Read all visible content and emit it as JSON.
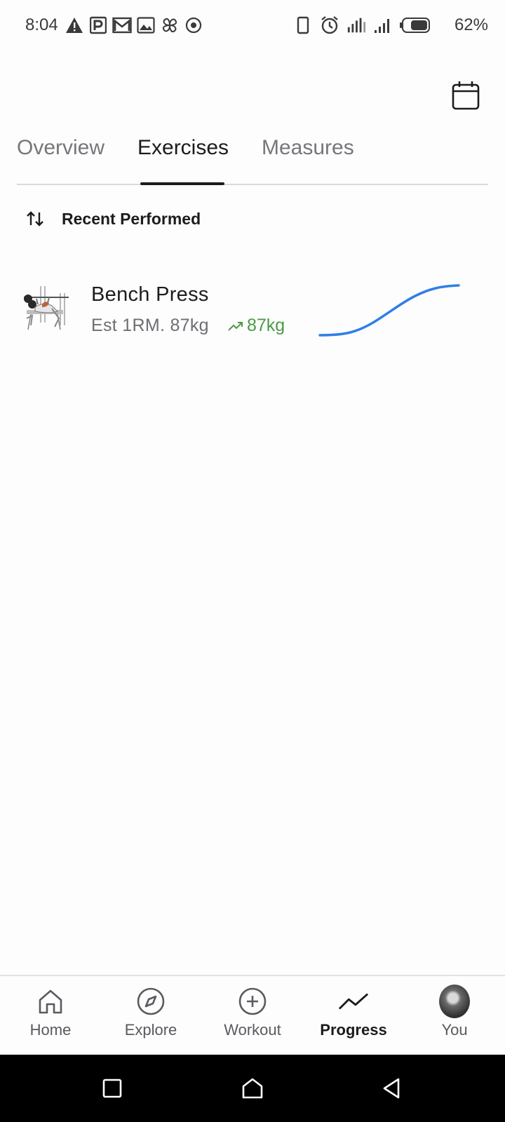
{
  "status_bar": {
    "time": "8:04",
    "battery_percent": "62%",
    "left_icons": [
      "warning-icon",
      "parking-icon",
      "gmail-icon",
      "image-icon",
      "pinwheel-icon",
      "target-icon"
    ],
    "right_icons": [
      "vibrate-icon",
      "alarm-icon",
      "signal-icon",
      "signal-icon",
      "battery-icon"
    ]
  },
  "header": {
    "calendar_icon": "calendar-icon"
  },
  "tabs": [
    {
      "label": "Overview",
      "active": false
    },
    {
      "label": "Exercises",
      "active": true
    },
    {
      "label": "Measures",
      "active": false
    }
  ],
  "sort": {
    "label": "Recent Performed",
    "icon": "sort-arrows-icon"
  },
  "exercises": [
    {
      "name": "Bench Press",
      "estimate": "Est 1RM. 87kg",
      "trend": "87kg",
      "trend_icon": "trending-up-icon"
    }
  ],
  "bottom_nav": [
    {
      "label": "Home",
      "icon": "home-icon",
      "active": false
    },
    {
      "label": "Explore",
      "icon": "compass-icon",
      "active": false
    },
    {
      "label": "Workout",
      "icon": "plus-circle-icon",
      "active": false
    },
    {
      "label": "Progress",
      "icon": "trending-line-icon",
      "active": true
    },
    {
      "label": "You",
      "icon": "avatar",
      "active": false
    }
  ],
  "colors": {
    "accent_line": "#2f7fe6",
    "trend_green": "#4c9a43",
    "text_primary": "#1c1c1e",
    "text_muted": "#76767b"
  }
}
